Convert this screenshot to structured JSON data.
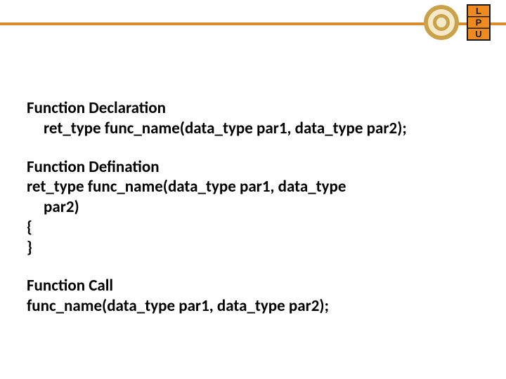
{
  "colors": {
    "rule": "#d98e2b",
    "lpu_orange": "#f08a1f",
    "lpu_dark": "#1a1a1a",
    "seal_outer": "#c9a24a",
    "seal_inner": "#f4e9c8"
  },
  "logos": {
    "seal_name": "university-seal-icon",
    "lpu_name": "lpu-logo-icon",
    "lpu_letters": [
      "L",
      "P",
      "U"
    ]
  },
  "sections": [
    {
      "heading": "Function Declaration",
      "lines": [
        {
          "text": "ret_type  func_name(data_type par1, data_type par2);",
          "indent": true
        }
      ]
    },
    {
      "heading": "Function Defination",
      "lines": [
        {
          "text": "ret_type  func_name(data_type par1, data_type",
          "indent": false
        },
        {
          "text": "par2)",
          "indent": true
        },
        {
          "text": "{",
          "indent": false
        },
        {
          "text": "}",
          "indent": false
        }
      ]
    },
    {
      "heading": "Function Call",
      "lines": [
        {
          "text": "func_name(data_type par1, data_type par2);",
          "indent": false
        }
      ]
    }
  ]
}
